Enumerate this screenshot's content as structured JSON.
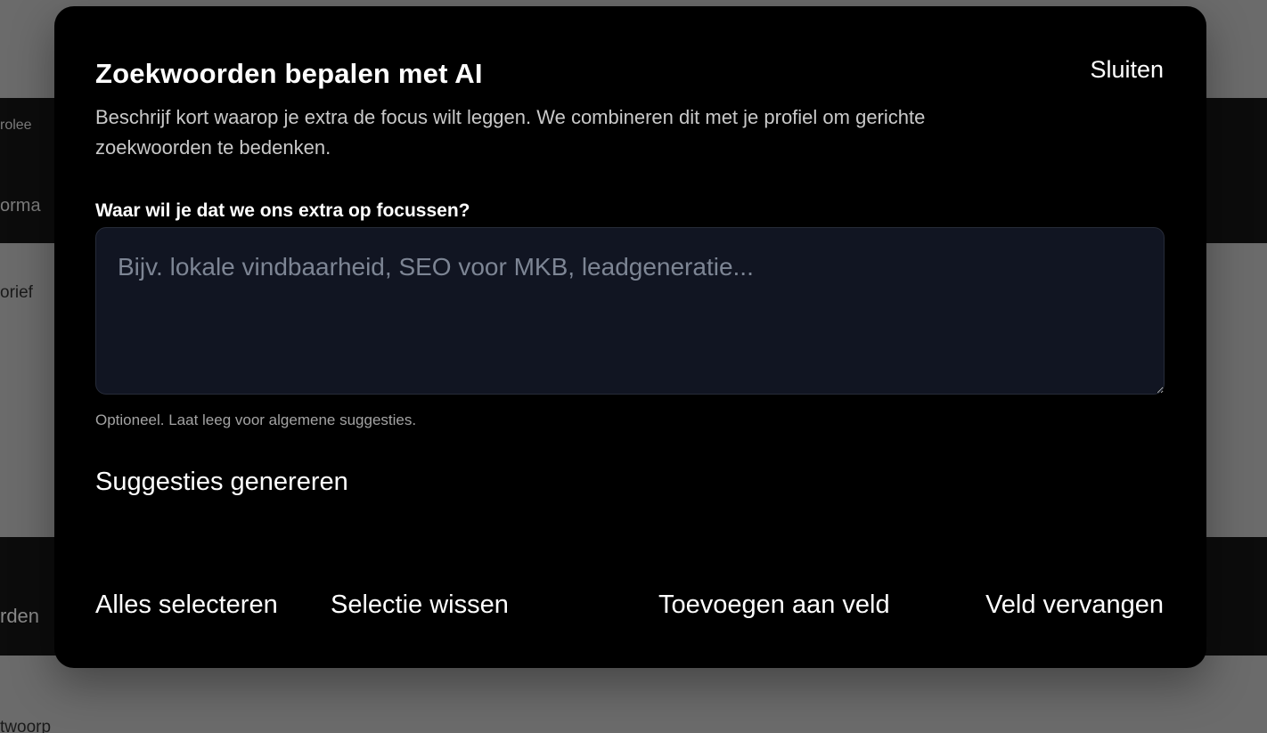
{
  "background": {
    "fragments": [
      "rolee",
      "orma",
      "orief",
      "rden",
      "twoorp"
    ]
  },
  "modal": {
    "title": "Zoekwoorden bepalen met AI",
    "close_label": "Sluiten",
    "description": "Beschrijf kort waarop je extra de focus wilt leggen. We combineren dit met je profiel om gerichte zoekwoorden te bedenken.",
    "field_label": "Waar wil je dat we ons extra op focussen?",
    "field_value": "",
    "field_placeholder": "Bijv. lokale vindbaarheid, SEO voor MKB, leadgeneratie...",
    "hint": "Optioneel. Laat leeg voor algemene suggesties.",
    "generate_label": "Suggesties genereren",
    "actions": {
      "select_all": "Alles selecteren",
      "clear_selection": "Selectie wissen",
      "add_to_field": "Toevoegen aan veld",
      "replace_field": "Veld vervangen"
    }
  },
  "colors": {
    "modal_bg": "#000000",
    "overlay": "#6b6b6b",
    "input_bg": "#111522"
  }
}
